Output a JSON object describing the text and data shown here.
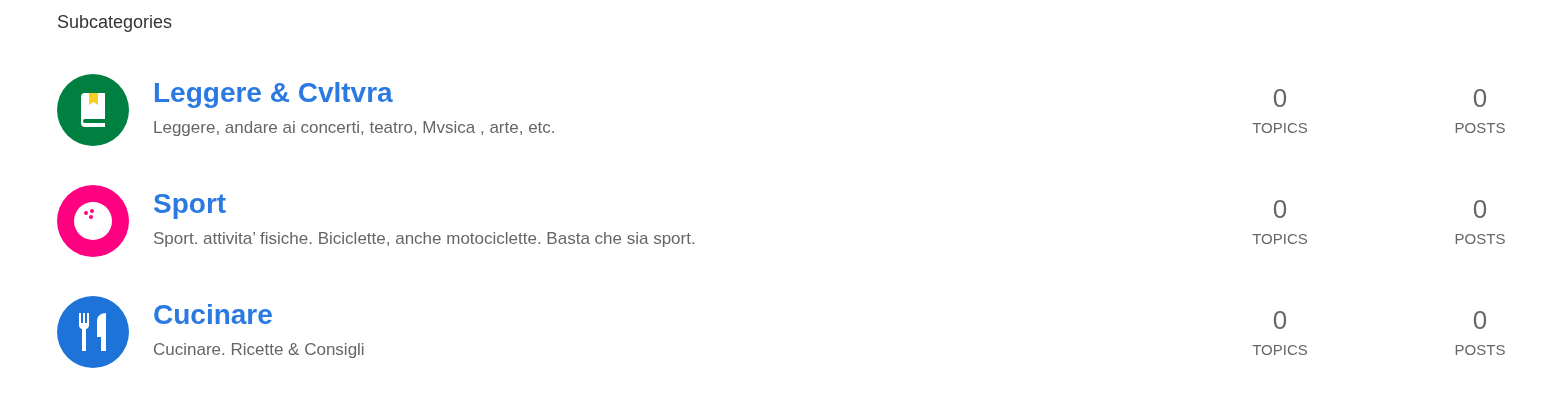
{
  "heading": "Subcategories",
  "categories": [
    {
      "kind": "book",
      "color": "#008040",
      "title": "Leggere & Cvltvra",
      "description": "Leggere, andare ai concerti, teatro, Mvsica , arte, etc.",
      "topics": "0",
      "topics_label": "TOPICS",
      "posts": "0",
      "posts_label": "POSTS"
    },
    {
      "kind": "bowling",
      "color": "#ff0080",
      "title": "Sport",
      "description": "Sport. attivita’ fisiche. Biciclette, anche motociclette. Basta che sia sport.",
      "topics": "0",
      "topics_label": "TOPICS",
      "posts": "0",
      "posts_label": "POSTS"
    },
    {
      "kind": "utensils",
      "color": "#1e73d9",
      "title": "Cucinare",
      "description": "Cucinare. Ricette & Consigli",
      "topics": "0",
      "topics_label": "TOPICS",
      "posts": "0",
      "posts_label": "POSTS"
    }
  ]
}
